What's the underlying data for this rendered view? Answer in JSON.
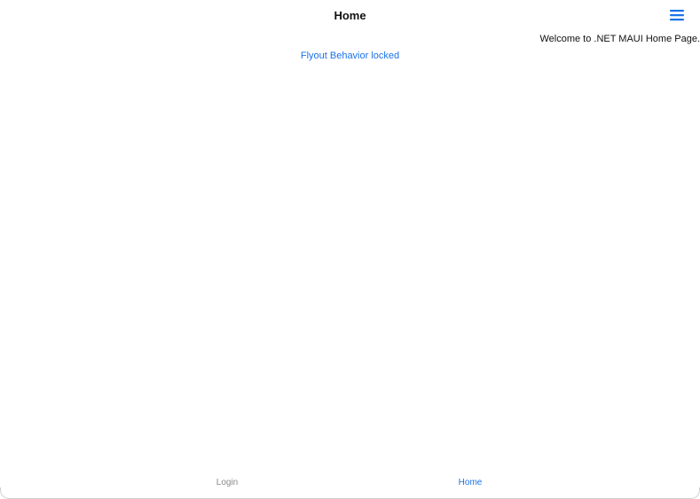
{
  "header": {
    "title": "Home",
    "menu_icon": "hamburger-menu-icon"
  },
  "main": {
    "welcome_text": "Welcome to .NET MAUI Home Page.",
    "flyout_link": "Flyout Behavior locked"
  },
  "tabs": [
    {
      "label": "Login",
      "selected": false
    },
    {
      "label": "Home",
      "selected": true
    }
  ],
  "colors": {
    "accent": "#1a73e8",
    "inactive_tab": "#8a8a8a",
    "text": "#111111",
    "background": "#ffffff"
  }
}
